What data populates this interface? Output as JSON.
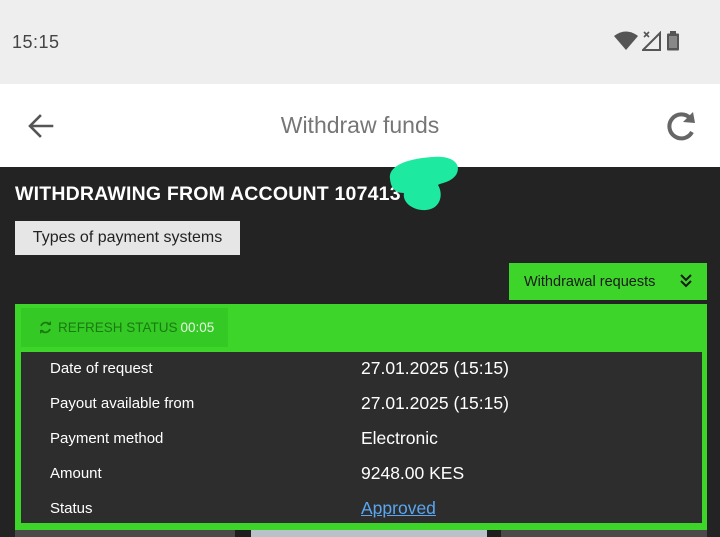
{
  "status_bar": {
    "time": "15:15",
    "icons": [
      "wifi-icon",
      "signal-icon",
      "battery-icon"
    ]
  },
  "app_bar": {
    "title": "Withdraw funds",
    "back_icon": "arrow-left-icon",
    "refresh_icon": "refresh-icon"
  },
  "account": {
    "heading": "WITHDRAWING FROM ACCOUNT 107413"
  },
  "buttons": {
    "types_label": "Types of payment systems",
    "requests_label": "Withdrawal requests"
  },
  "request": {
    "refresh_label": "REFRESH STATUS",
    "refresh_timer": "00:05",
    "rows": [
      {
        "label": "Date of request",
        "value": "27.01.2025 (15:15)"
      },
      {
        "label": "Payout available from",
        "value": "27.01.2025 (15:15)"
      },
      {
        "label": "Payment method",
        "value": "Electronic"
      },
      {
        "label": "Amount",
        "value": "9248.00 KES"
      },
      {
        "label": "Status",
        "value": "Approved"
      }
    ]
  },
  "colors": {
    "accent_green": "#3ed52b",
    "background": "#232323",
    "link_blue": "#5aa6f0",
    "redaction": "#1de9a0"
  }
}
